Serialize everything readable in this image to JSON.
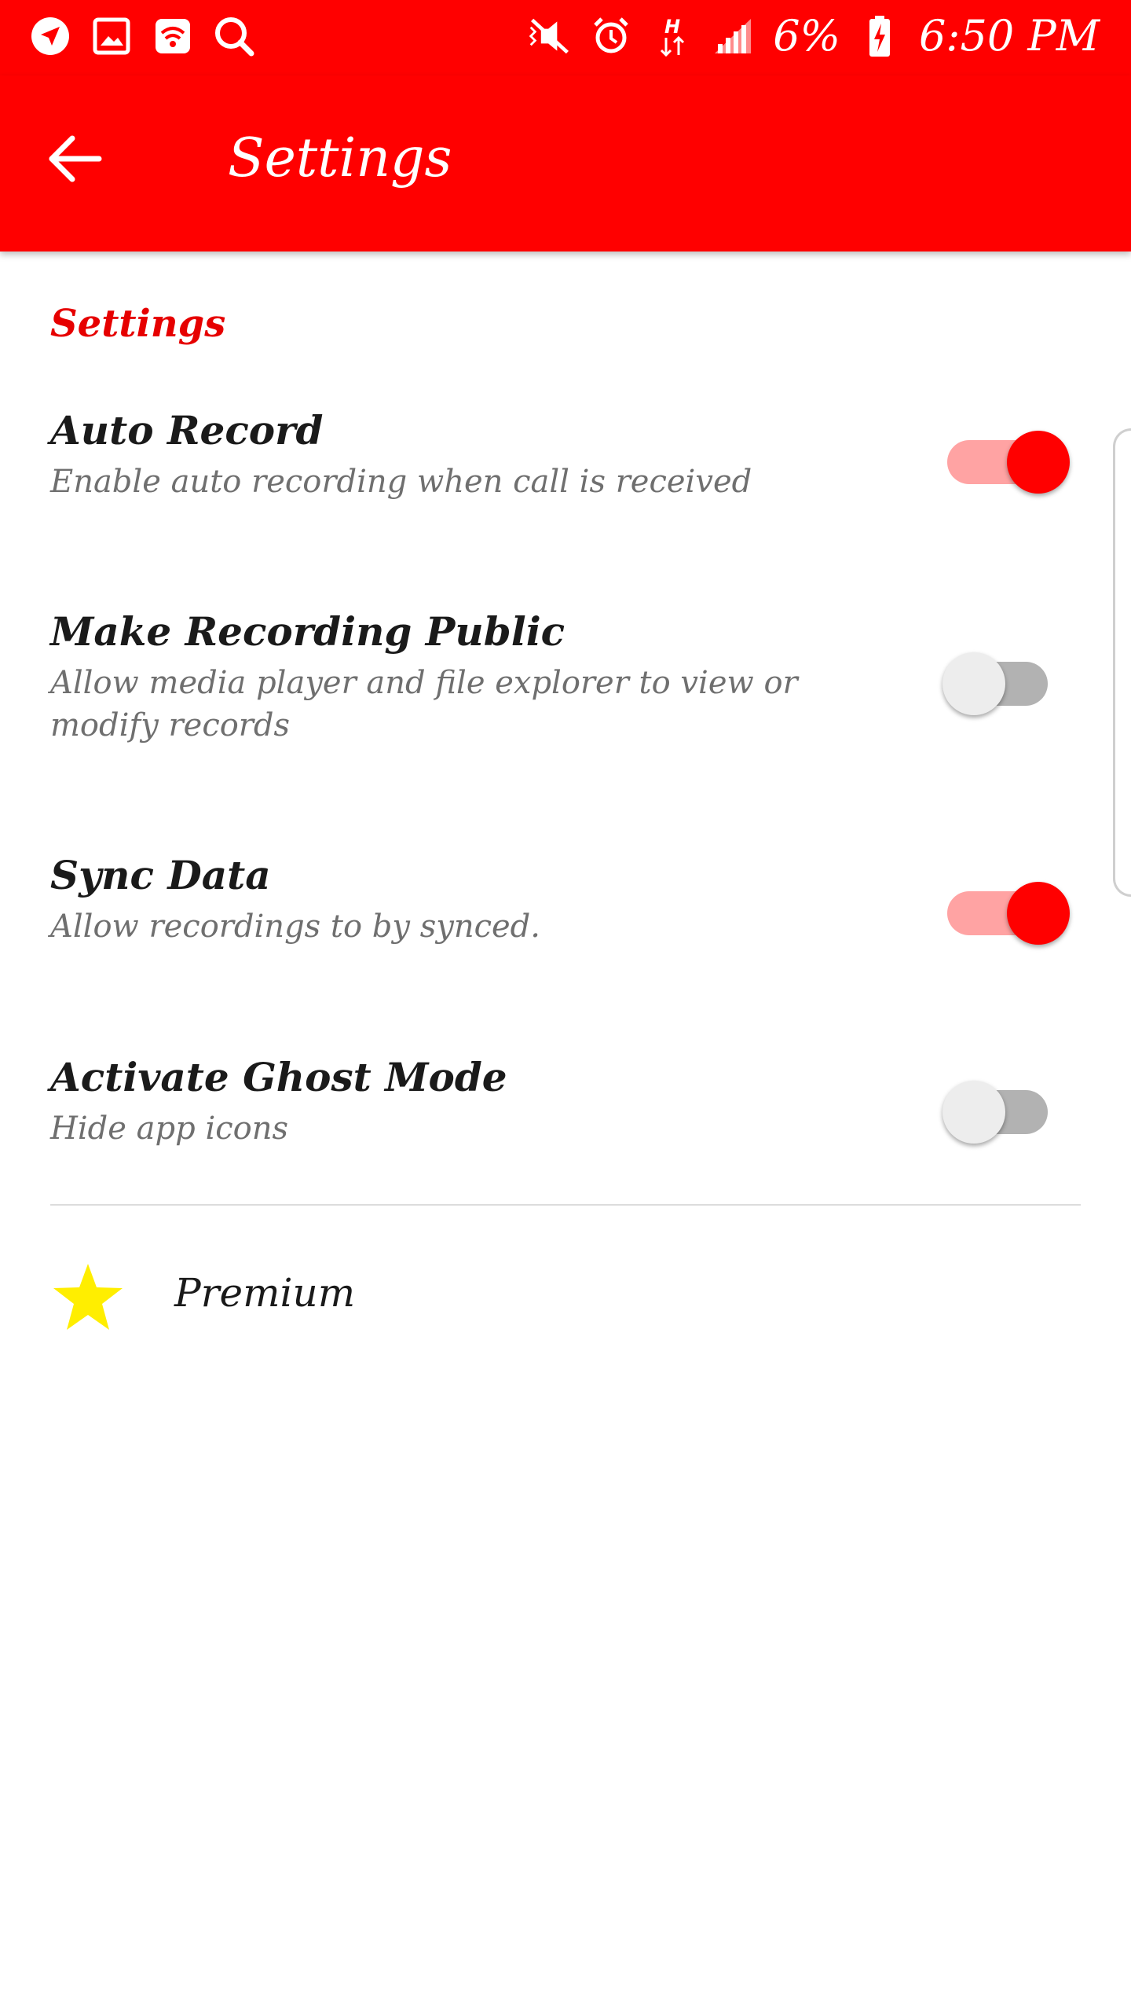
{
  "status_bar": {
    "battery": "6%",
    "time": "6:50 PM",
    "network_label": "H",
    "icons": [
      "navigation-icon",
      "gallery-icon",
      "wifi-hotspot-icon",
      "search-icon",
      "mute-icon",
      "alarm-icon",
      "data-arrows-icon",
      "signal-icon",
      "battery-charging-icon"
    ],
    "text_color": "#ffffff"
  },
  "app_bar": {
    "title": "Settings",
    "background": "#ff0000",
    "back_icon": "arrow-back-icon"
  },
  "section": {
    "header": "Settings",
    "header_color": "#e60000"
  },
  "preferences": [
    {
      "title": "Auto Record",
      "summary": "Enable auto recording when call is received",
      "enabled": true
    },
    {
      "title": "Make Recording Public",
      "summary": "Allow media player and file explorer to view or modify records",
      "enabled": false
    },
    {
      "title": "Sync Data",
      "summary": "Allow recordings to by synced.",
      "enabled": true
    },
    {
      "title": "Activate Ghost Mode",
      "summary": "Hide app icons",
      "enabled": false
    }
  ],
  "premium": {
    "label": "Premium",
    "icon": "star-icon",
    "icon_color": "#ffee00"
  },
  "colors": {
    "accent": "#ff0000",
    "switch_on_track": "#ffa3a3",
    "switch_off_thumb": "#ededed",
    "switch_off_track": "#b2b2b2"
  }
}
